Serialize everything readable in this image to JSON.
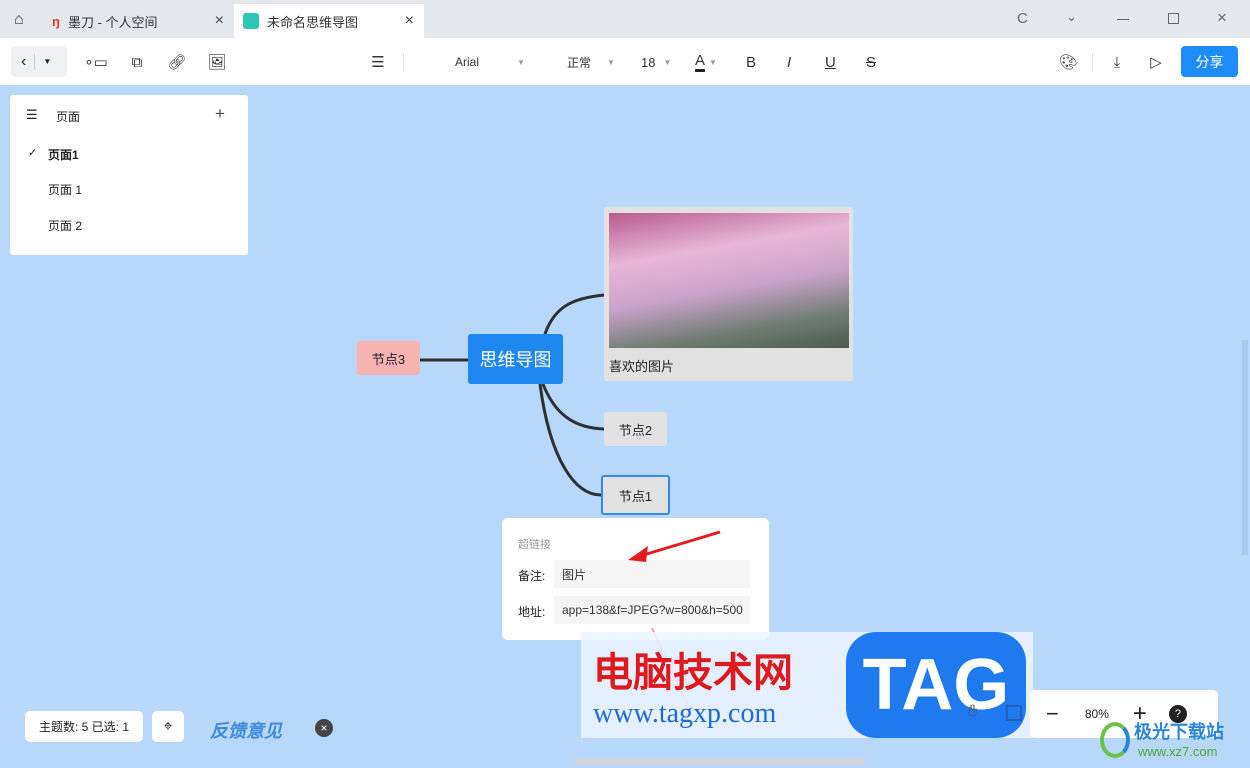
{
  "tabs": [
    {
      "label": "墨刀 - 个人空间"
    },
    {
      "label": "未命名思维导图"
    }
  ],
  "toolbar": {
    "font": "Arial",
    "weight": "正常",
    "size": "18",
    "bold": "B",
    "italic": "I",
    "underline": "U",
    "strike": "S",
    "color_letter": "A",
    "share": "分享"
  },
  "pages": {
    "title": "页面",
    "items": [
      "页面1",
      "页面 1",
      "页面 2"
    ]
  },
  "mindmap": {
    "root": "思维导图",
    "image_caption": "喜欢的图片",
    "nodes": [
      "节点3",
      "节点2",
      "节点1"
    ]
  },
  "popup": {
    "title": "超链接",
    "note_label": "备注:",
    "note_value": "图片",
    "addr_label": "地址:",
    "addr_value": "app=138&f=JPEG?w=800&h=500"
  },
  "status": {
    "stats": "主题数: 5 已选: 1",
    "feedback": "反馈意见",
    "zoom": "80%",
    "help": "?"
  },
  "watermarks": {
    "cn": "电脑技术网",
    "tag": "TAG",
    "url": "www.tagxp.com",
    "site": "极光下载站",
    "site_url": "www.xz7.com"
  }
}
